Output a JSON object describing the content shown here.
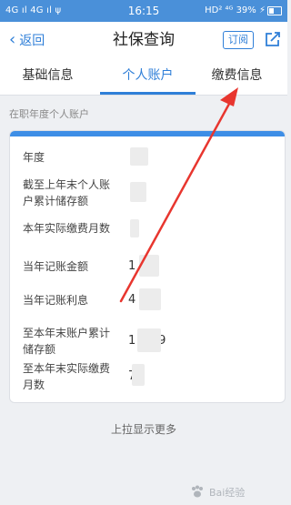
{
  "status_bar": {
    "left": "4G ıl 4G ıl ψ",
    "time": "16:15",
    "right": "HD² ⁴ᴳ 39% ⚡"
  },
  "nav": {
    "back_label": "返回",
    "title": "社保查询",
    "subscribe_label": "订阅",
    "share_icon": "share-icon"
  },
  "tabs": [
    {
      "label": "基础信息",
      "active": false
    },
    {
      "label": "个人账户",
      "active": true
    },
    {
      "label": "缴费信息",
      "active": false
    }
  ],
  "section_label": "在职年度个人账户",
  "account_rows": [
    {
      "label": "年度",
      "value": ""
    },
    {
      "label": "截至上年末个人账户累计储存额",
      "value": ""
    },
    {
      "label": "本年实际缴费月数",
      "value": " "
    },
    {
      "label": "当年记账金额",
      "value": "1"
    },
    {
      "label": "当年记账利息",
      "value": "4"
    },
    {
      "label": "至本年末账户累计储存额",
      "value": "1      9"
    },
    {
      "label": "至本年末实际缴费月数",
      "value": "7"
    }
  ],
  "load_more": "上拉显示更多",
  "watermark": "Bai经验",
  "colors": {
    "accent": "#2f7fd8",
    "status_bar": "#4a90d9",
    "arrow": "#e8362f"
  }
}
